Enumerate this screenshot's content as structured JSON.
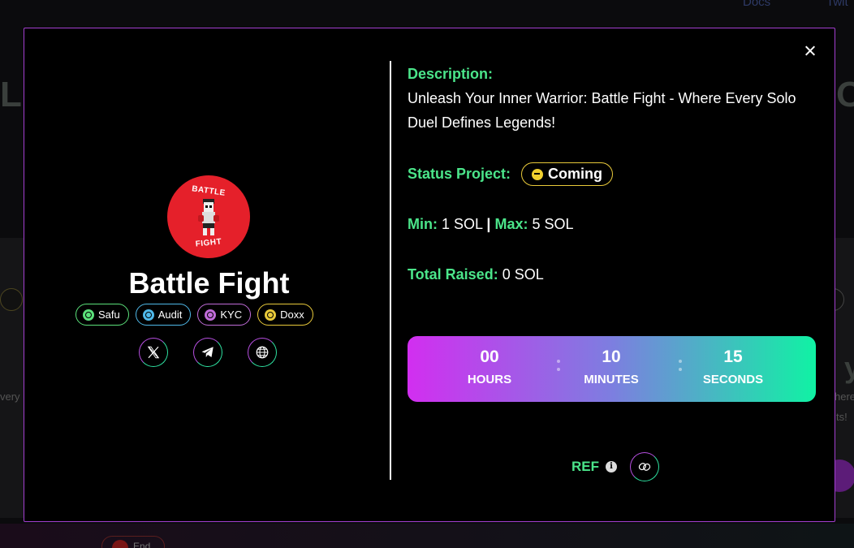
{
  "background": {
    "nav_items": [
      "Docs",
      "Twit"
    ],
    "left_text": "very",
    "right_text_1": "here",
    "right_text_2": "ts!",
    "end_label": "End"
  },
  "modal": {
    "project": {
      "name": "Battle Fight",
      "logo_top_text": "BATTLE",
      "logo_bottom_text": "FIGHT",
      "logo_color": "#e5202a"
    },
    "badges": [
      {
        "label": "Safu",
        "icon": "safu-icon",
        "color": "#5be07a"
      },
      {
        "label": "Audit",
        "icon": "audit-icon",
        "color": "#4fb8e8"
      },
      {
        "label": "KYC",
        "icon": "kyc-icon",
        "color": "#c06cd8"
      },
      {
        "label": "Doxx",
        "icon": "doxx-icon",
        "color": "#e8c93a"
      }
    ],
    "socials": [
      {
        "name": "x-twitter",
        "icon": "x-icon"
      },
      {
        "name": "telegram",
        "icon": "telegram-icon"
      },
      {
        "name": "website",
        "icon": "globe-icon"
      }
    ],
    "description": {
      "label": "Description:",
      "text": "Unleash Your Inner Warrior: Battle Fight - Where Every Solo Duel Defines Legends!"
    },
    "status": {
      "label": "Status Project:",
      "value": "Coming",
      "color": "#e8c93a"
    },
    "limits": {
      "min_label": "Min:",
      "min_value": "1 SOL",
      "separator": "|",
      "max_label": "Max:",
      "max_value": "5 SOL"
    },
    "raised": {
      "label": "Total Raised:",
      "value": "0 SOL"
    },
    "countdown": {
      "hours": "00",
      "hours_label": "HOURS",
      "minutes": "10",
      "minutes_label": "MINUTES",
      "seconds": "15",
      "seconds_label": "SECONDS"
    },
    "ref": {
      "label": "REF",
      "info": "i"
    },
    "colors": {
      "accent_green": "#4be58a",
      "border_purple": "#a33fd0",
      "gradient_start": "#d22ef0",
      "gradient_end": "#10f2a4"
    }
  }
}
